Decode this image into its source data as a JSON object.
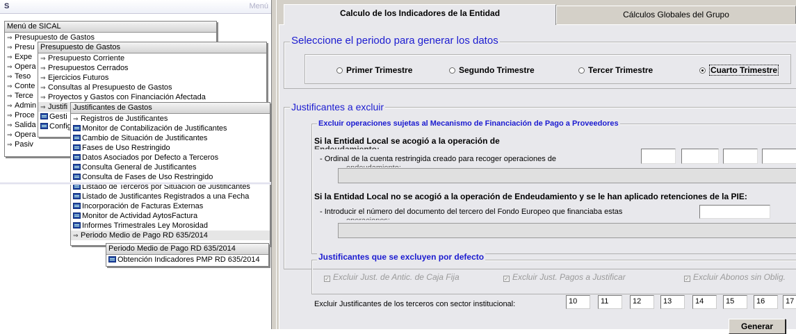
{
  "left": {
    "window_menu_label": "Menú",
    "root": {
      "title": "Menú de SICAL",
      "items": [
        "Presupuesto de Gastos",
        "Presu",
        "Expe",
        "Opera",
        "Teso",
        "Conte",
        "Terce",
        "Admin",
        "Proce",
        "Salida",
        "Opera",
        "Pasiv"
      ]
    },
    "presupuesto": {
      "title": "Presupuesto de Gastos",
      "items": [
        "Presupuesto Corriente",
        "Presupuestos Cerrados",
        "Ejercicios Futuros",
        "Consultas al Presupuesto de Gastos",
        "Proyectos y Gastos con Financiación Afectada",
        "Justifi",
        "Gesti",
        "Config"
      ]
    },
    "justificantes": {
      "title": "Justificantes de Gastos",
      "items": [
        "Registros de Justificantes",
        "Monitor de Contabilización de Justificantes",
        "Cambio de Situación de Justificantes",
        "Fases de Uso Restringido",
        "Datos Asociados por Defecto a Terceros",
        "Consulta General de Justificantes",
        "Consulta de Fases de Uso Restringido",
        "Listado de Terceros por Situación de Justificantes",
        "Listado de Justificantes Registrados a una Fecha",
        "Incorporación de Facturas Externas",
        "Monitor de Actividad AytosFactura",
        "Informes Trimestrales Ley Morosidad",
        "Periodo Medio de Pago RD 635/2014"
      ]
    },
    "pmp": {
      "title": "Periodo Medio de Pago RD 635/2014",
      "items": [
        "Obtención Indicadores PMP RD 635/2014"
      ]
    }
  },
  "tabs": [
    "Calculo de los Indicadores de la Entidad",
    "Cálculos Globales del Grupo"
  ],
  "periodo": {
    "legend": "Seleccione el periodo para generar los datos",
    "options": [
      "Primer Trimestre",
      "Segundo Trimestre",
      "Tercer Trimestre",
      "Cuarto Trimestre"
    ],
    "selected": "Cuarto Trimestre"
  },
  "excluir": {
    "legend": "Justificantes a excluir",
    "sub_legend": "Excluir operaciones sujetas al Mecanismo de Financiación de Pago a Proveedores",
    "q1": "Si la Entidad Local se acogió a la operación de",
    "q1_cut": "Endeudamiento:",
    "q1_field": "- Ordinal de la cuenta restringida creado para recoger operaciones de",
    "q1_field_cut": "endeudamiento:",
    "q2": "Si la Entidad Local no se acogió a la operación de Endeudamiento y se le han aplicado retenciones de la PIE:",
    "q2_field": "- Introducir el número del documento del tercero del Fondo Europeo que financiaba estas",
    "q2_field_cut": "operaciones:"
  },
  "defecto": {
    "legend": "Justificantes que se excluyen por defecto",
    "checks": [
      "Excluir Just. de Antic. de Caja Fija",
      "Excluir Just. Pagos a Justificar",
      "Excluir Abonos sin Oblig."
    ],
    "check_mark": "✓"
  },
  "sector": {
    "label": "Excluir Justificantes de los terceros con sector institucional:",
    "values": [
      "10",
      "11",
      "12",
      "13",
      "14",
      "15",
      "16",
      "17"
    ]
  },
  "generar_label": "Generar"
}
